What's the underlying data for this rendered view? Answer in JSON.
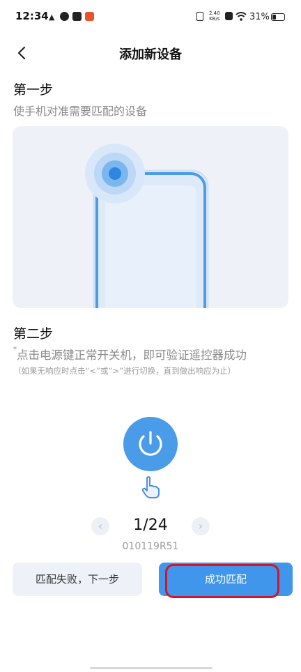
{
  "status_bar": {
    "time": "12:34",
    "net_speed_value": "2.40",
    "net_speed_unit": "KB/s",
    "battery": "31%",
    "battery_level": 0.31
  },
  "header": {
    "title": "添加新设备"
  },
  "step1": {
    "title": "第一步",
    "description": "使手机对准需要匹配的设备"
  },
  "step2": {
    "title": "第二步",
    "bullet": "*",
    "description": "点击电源键正常开关机，即可验证遥控器成功",
    "hint": "（如果无响应时点击“<”或“>”进行切换，直到做出响应为止）"
  },
  "pager": {
    "page": "1/24",
    "code": "010119R51",
    "prev": "‹",
    "next": "›"
  },
  "buttons": {
    "fail": "匹配失败，下一步",
    "success": "成功匹配"
  },
  "colors": {
    "accent": "#3f96ea",
    "power": "#4a9be8",
    "highlight": "#d4142a",
    "illustration_bg": "#eef2f8"
  },
  "icons": {
    "back": "chevron-left-icon",
    "power": "power-icon",
    "hand": "pointing-hand-icon"
  }
}
